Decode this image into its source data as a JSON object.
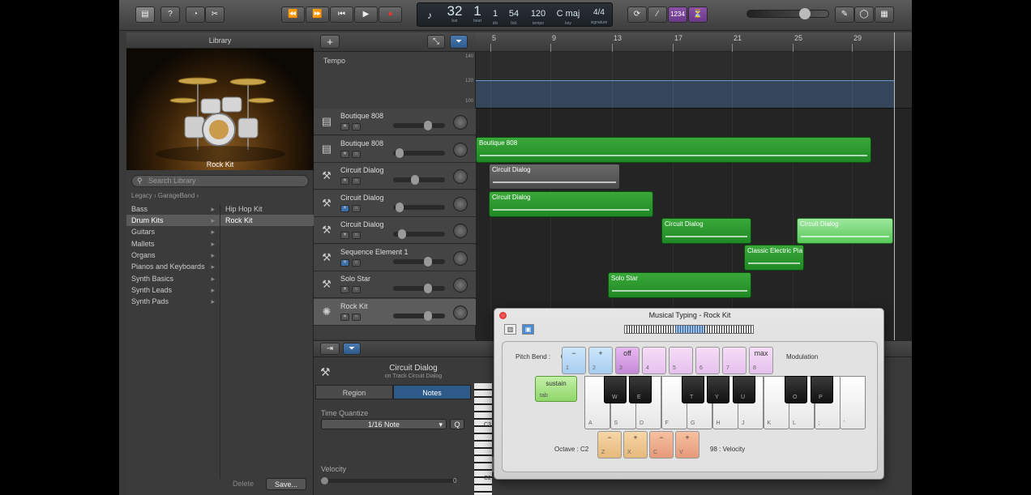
{
  "toolbar": {
    "library_icon": "library-icon",
    "help_label": "?",
    "transport": [
      "⏪",
      "⏩",
      "⏮",
      "▶",
      "●"
    ],
    "lcd": {
      "bar": "32",
      "bar_label": "bar",
      "beat": "1",
      "beat_label": "beat",
      "div": "1",
      "div_label": "div",
      "tick": "54",
      "tick_label": "tick",
      "tempo": "120",
      "tempo_label": "tempo",
      "key": "C maj",
      "key_label": "key",
      "signature": "4/4",
      "signature_label": "signature"
    },
    "count_in": "1234",
    "accent_color": "#8a50a8"
  },
  "library": {
    "title": "Library",
    "selected_patch": "Rock Kit",
    "search_placeholder": "Search Library",
    "breadcrumb": "Legacy  ›  GarageBand  ›",
    "categories": [
      "Bass",
      "Drum Kits",
      "Guitars",
      "Mallets",
      "Organs",
      "Pianos and Keyboards",
      "Synth Basics",
      "Synth Leads",
      "Synth Pads"
    ],
    "subitems": [
      "Hip Hop Kit",
      "Rock Kit"
    ],
    "delete_label": "Delete",
    "save_label": "Save..."
  },
  "tempo_track": {
    "label": "Tempo",
    "scale": [
      "140",
      "120",
      "100"
    ]
  },
  "tracks": [
    {
      "name": "Boutique 808",
      "icon": "drum-machine-icon",
      "volume": 0.7
    },
    {
      "name": "Boutique 808",
      "icon": "drum-machine-icon",
      "volume": 0.05
    },
    {
      "name": "Circuit Dialog",
      "icon": "synth-icon",
      "volume": 0.4
    },
    {
      "name": "Circuit Dialog",
      "icon": "synth-icon",
      "volume": 0.05
    },
    {
      "name": "Circuit Dialog",
      "icon": "synth-icon",
      "volume": 0.12
    },
    {
      "name": "Sequence Element 1",
      "icon": "synth-icon",
      "volume": 0.7
    },
    {
      "name": "Solo Star",
      "icon": "synth-icon",
      "volume": 0.7
    },
    {
      "name": "Rock Kit",
      "icon": "drum-kit-icon",
      "volume": 0.7
    }
  ],
  "ruler": [
    "5",
    "9",
    "13",
    "17",
    "21",
    "25",
    "29"
  ],
  "regions": [
    {
      "name": "Boutique 808"
    },
    {
      "name": "Circuit Dialog"
    },
    {
      "name": "Circuit Dialog"
    },
    {
      "name": "Circuit Dialog"
    },
    {
      "name": "Circuit Dialog"
    },
    {
      "name": "Classic Electric Pia"
    },
    {
      "name": "Solo Star"
    }
  ],
  "editor": {
    "track_name": "Circuit Dialog",
    "track_sub": "on Track Circuit Dialog",
    "tab_region": "Region",
    "tab_notes": "Notes",
    "tq_label": "Time Quantize",
    "tq_value": "1/16 Note",
    "tq_q": "Q",
    "velocity_label": "Velocity",
    "velocity_value": "0",
    "c_labels": [
      "C3",
      "C2"
    ]
  },
  "musical_typing": {
    "title": "Musical Typing - Rock Kit",
    "pitch_bend_label": "Pitch Bend :",
    "pitch_bend_value": "0",
    "modulation_label": "Modulation",
    "pitch_keys": [
      {
        "sym": "−",
        "letter": "1"
      },
      {
        "sym": "+",
        "letter": "2"
      },
      {
        "sym": "off",
        "letter": "3"
      },
      {
        "sym": "",
        "letter": "4"
      },
      {
        "sym": "",
        "letter": "5"
      },
      {
        "sym": "",
        "letter": "6"
      },
      {
        "sym": "",
        "letter": "7"
      },
      {
        "sym": "max",
        "letter": "8"
      }
    ],
    "sustain_label": "sustain",
    "sustain_key": "tab",
    "white_keys": [
      "A",
      "S",
      "D",
      "F",
      "G",
      "H",
      "J",
      "K",
      "L",
      ";",
      "'"
    ],
    "black_keys": [
      "W",
      "E",
      "T",
      "Y",
      "U",
      "O",
      "P"
    ],
    "octave_label": "Octave :  C2",
    "velocity_label": "98 : Velocity",
    "bottom_keys": [
      {
        "sym": "−",
        "letter": "Z"
      },
      {
        "sym": "+",
        "letter": "X"
      },
      {
        "sym": "−",
        "letter": "C"
      },
      {
        "sym": "+",
        "letter": "V"
      }
    ]
  }
}
